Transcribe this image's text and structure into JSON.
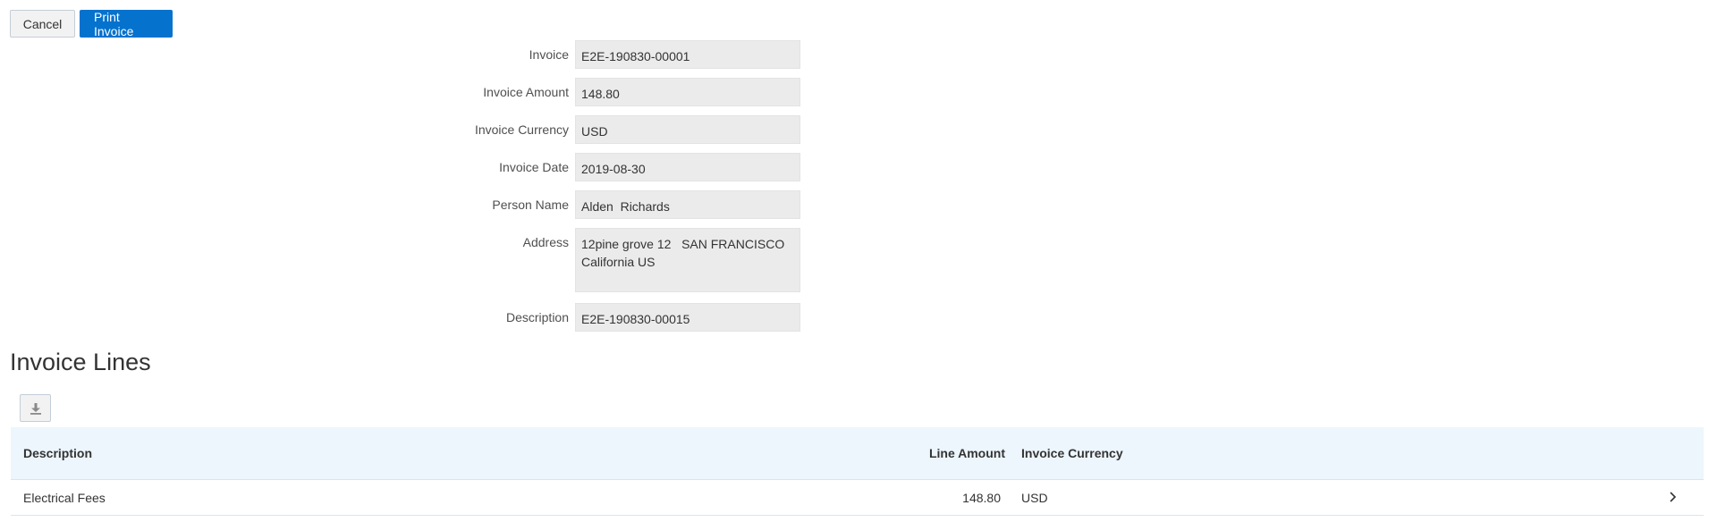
{
  "toolbar": {
    "cancel_label": "Cancel",
    "print_label": "Print Invoice"
  },
  "form": {
    "invoice_label": "Invoice",
    "invoice_value": "E2E-190830-00001",
    "amount_label": "Invoice Amount",
    "amount_value": "148.80",
    "currency_label": "Invoice Currency",
    "currency_value": "USD",
    "date_label": "Invoice Date",
    "date_value": "2019-08-30",
    "person_label": "Person Name",
    "person_value": "Alden  Richards",
    "address_label": "Address",
    "address_line1": "12pine grove 12   SAN FRANCISCO",
    "address_line2": "California US",
    "description_label": "Description",
    "description_value": "E2E-190830-00015"
  },
  "invoice_lines": {
    "title": "Invoice Lines",
    "export_icon": "download-icon",
    "columns": {
      "description": "Description",
      "line_amount": "Line Amount",
      "currency": "Invoice Currency"
    },
    "rows": [
      {
        "description": "Electrical Fees",
        "line_amount": "148.80",
        "currency": "USD"
      }
    ]
  },
  "colors": {
    "primary": "#0572ce",
    "field_bg": "#ebebeb",
    "table_header_bg": "#edf6fd"
  }
}
